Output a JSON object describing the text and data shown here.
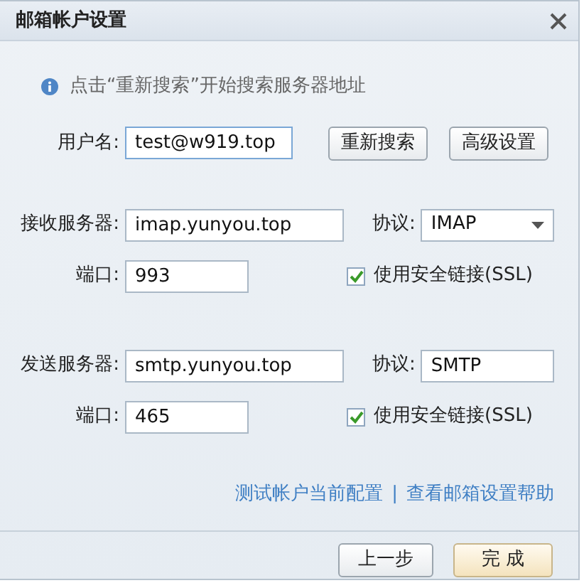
{
  "window": {
    "title": "邮箱帐户设置"
  },
  "info": "点击“重新搜索”开始搜索服务器地址",
  "username": {
    "label": "用户名:",
    "value": "test@w919.top",
    "focused": true
  },
  "search_buttons": [
    "重新搜索",
    "高级设置"
  ],
  "servers": [
    {
      "server_label": "接收服务器:",
      "server": "imap.yunyou.top",
      "protocol_label": "协议:",
      "protocol": {
        "kind": "dropdown",
        "value": "IMAP"
      },
      "port_label": "端口:",
      "port": "993",
      "ssl_label": "使用安全链接(SSL)",
      "ssl": true
    },
    {
      "server_label": "发送服务器:",
      "server": "smtp.yunyou.top",
      "protocol_label": "协议:",
      "protocol": {
        "kind": "field",
        "value": "SMTP"
      },
      "port_label": "端口:",
      "port": "465",
      "ssl_label": "使用安全链接(SSL)",
      "ssl": true
    }
  ],
  "links": [
    "测试帐户当前配置",
    "查看邮箱设置帮助"
  ],
  "link_separator": "|",
  "footer_buttons": [
    {
      "label": "上一步",
      "primary": false
    },
    {
      "label": "完 成",
      "primary": true
    }
  ]
}
